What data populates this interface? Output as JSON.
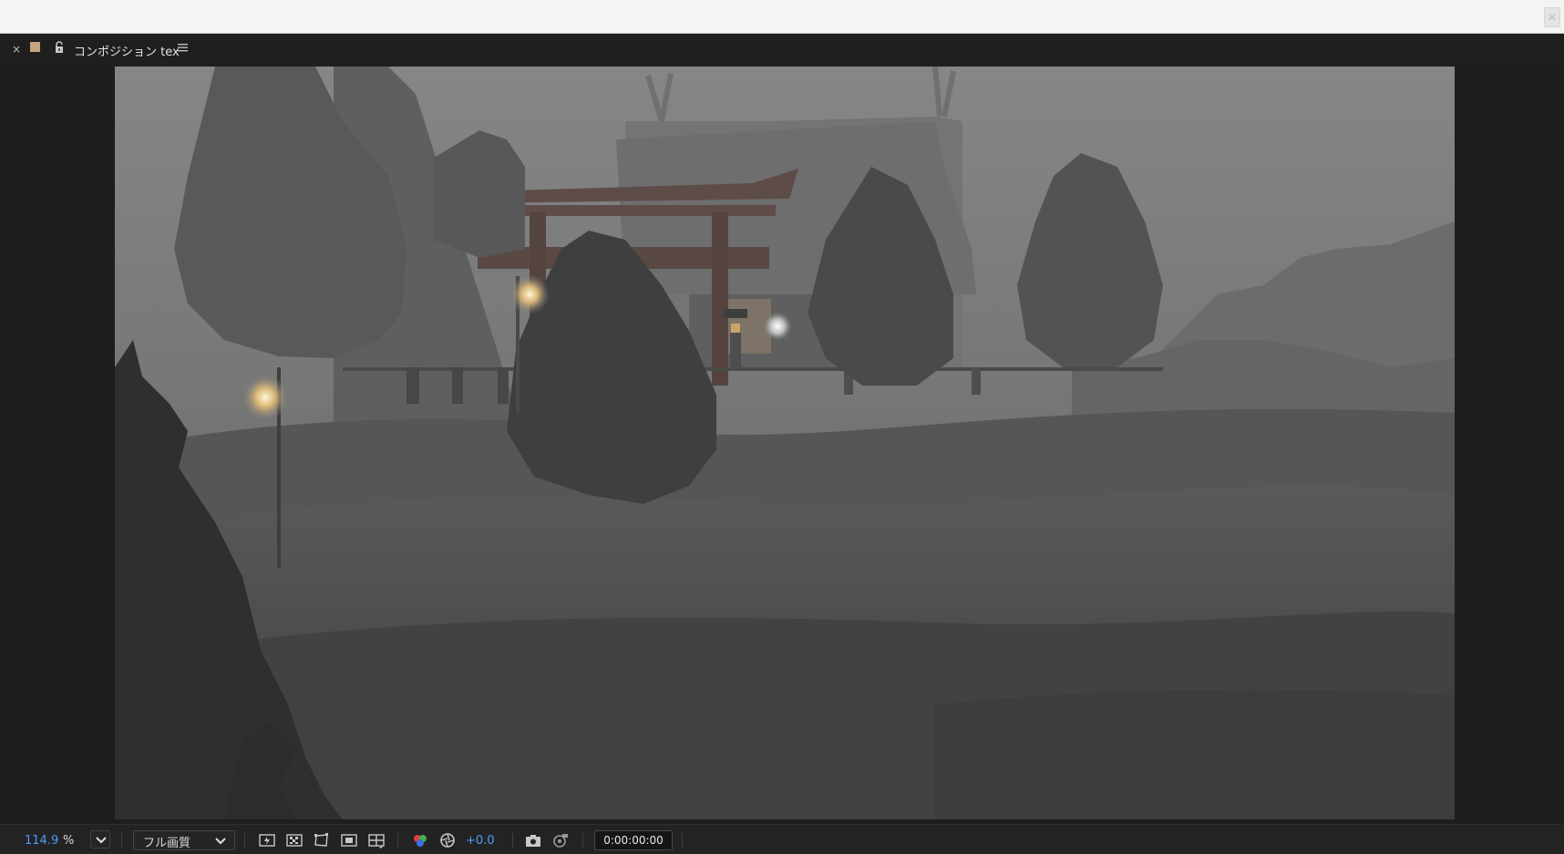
{
  "panel": {
    "close_glyph": "×",
    "title": "コンポジション tex",
    "label_color": "#c7a37e",
    "icons": [
      "close-icon",
      "lock-icon",
      "panel-menu-icon"
    ]
  },
  "viewer": {
    "content": "foggy shrine scene with torii gate, lanterns and trees"
  },
  "bottom_bar": {
    "zoom_value": "114.9",
    "zoom_unit": "%",
    "quality": "フル画質",
    "exposure": "+0.0",
    "timecode": "0:00:00:00",
    "accent_color": "#4e9cf5"
  }
}
